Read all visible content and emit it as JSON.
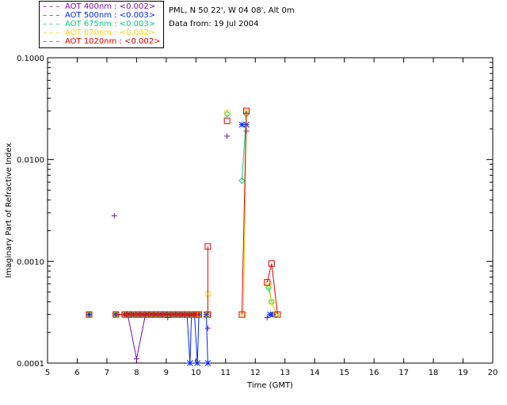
{
  "header": {
    "location": "PML, N 50 22', W 04 08', Alt 0m",
    "date_line": "Data from: 19 Jul 2004"
  },
  "legend": [
    {
      "label": "AOT  400nm : <0.002>",
      "color": "#7a0aa8"
    },
    {
      "label": "AOT  500nm : <0.003>",
      "color": "#0026ff"
    },
    {
      "label": "AOT  675nm : <0.003>",
      "color": "#00cc77"
    },
    {
      "label": "AOT  870nm : <0.002>",
      "color": "#ffd400"
    },
    {
      "label": "AOT 1020nm : <0.002>",
      "color": "#e00000"
    }
  ],
  "chart_data": {
    "type": "line",
    "xlabel": "Time (GMT)",
    "ylabel": "Imaginary Part of Refractive Index",
    "xlim": [
      5,
      20
    ],
    "ylim": [
      0.0001,
      0.1
    ],
    "yscale": "log",
    "x_ticks": [
      "5",
      "6",
      "7",
      "8",
      "9",
      "10",
      "11",
      "12",
      "13",
      "14",
      "15",
      "16",
      "17",
      "18",
      "19",
      "20"
    ],
    "y_ticks": [
      {
        "value": 0.0001,
        "label": "0.0001"
      },
      {
        "value": 0.001,
        "label": "0.0010"
      },
      {
        "value": 0.01,
        "label": "0.0100"
      },
      {
        "value": 0.1,
        "label": "0.1000"
      }
    ],
    "series": [
      {
        "name": "AOT  400nm",
        "color": "#7a0aa8",
        "marker": "plus",
        "segments": [
          [
            [
              7.25,
              0.0028
            ]
          ],
          [
            [
              7.7,
              0.0003
            ],
            [
              8.0,
              0.00011
            ],
            [
              8.3,
              0.0003
            ]
          ],
          [
            [
              9.05,
              0.00028
            ]
          ],
          [
            [
              10.4,
              0.00022
            ]
          ],
          [
            [
              11.05,
              0.017
            ]
          ],
          [
            [
              11.7,
              0.019
            ]
          ],
          [
            [
              12.4,
              0.00028
            ]
          ]
        ]
      },
      {
        "name": "AOT  500nm",
        "color": "#0026ff",
        "marker": "star",
        "segments": [
          [
            [
              6.4,
              0.0003
            ]
          ],
          [
            [
              7.3,
              0.0003
            ],
            [
              7.6,
              0.0003
            ],
            [
              7.75,
              0.0003
            ],
            [
              7.9,
              0.0003
            ],
            [
              8.05,
              0.0003
            ],
            [
              8.2,
              0.0003
            ],
            [
              8.35,
              0.0003
            ],
            [
              8.5,
              0.0003
            ],
            [
              8.65,
              0.0003
            ],
            [
              8.8,
              0.0003
            ],
            [
              8.95,
              0.0003
            ],
            [
              9.1,
              0.0003
            ],
            [
              9.25,
              0.0003
            ],
            [
              9.4,
              0.0003
            ],
            [
              9.55,
              0.0003
            ],
            [
              9.7,
              0.0003
            ],
            [
              9.8,
              0.0001
            ],
            [
              9.85,
              0.0003
            ],
            [
              9.95,
              0.0003
            ],
            [
              10.05,
              0.0001
            ],
            [
              10.1,
              0.0003
            ]
          ],
          [
            [
              10.35,
              0.0003
            ],
            [
              10.4,
              0.0001
            ]
          ],
          [
            [
              11.55,
              0.022
            ],
            [
              11.7,
              0.022
            ]
          ],
          [
            [
              12.5,
              0.0003
            ],
            [
              12.6,
              0.0003
            ]
          ]
        ]
      },
      {
        "name": "AOT  675nm",
        "color": "#00cc77",
        "marker": "diamond",
        "segments": [
          [
            [
              6.4,
              0.0003
            ]
          ],
          [
            [
              7.3,
              0.0003
            ],
            [
              7.6,
              0.0003
            ],
            [
              7.75,
              0.0003
            ],
            [
              7.9,
              0.0003
            ],
            [
              8.05,
              0.0003
            ],
            [
              8.2,
              0.0003
            ],
            [
              8.35,
              0.0003
            ],
            [
              8.5,
              0.0003
            ],
            [
              8.65,
              0.0003
            ],
            [
              8.8,
              0.0003
            ],
            [
              8.95,
              0.0003
            ],
            [
              9.1,
              0.0003
            ],
            [
              9.25,
              0.0003
            ],
            [
              9.4,
              0.0003
            ],
            [
              9.55,
              0.0003
            ],
            [
              9.7,
              0.0003
            ],
            [
              9.85,
              0.0003
            ],
            [
              10.0,
              0.0003
            ],
            [
              10.1,
              0.0003
            ]
          ],
          [
            [
              10.4,
              0.0003
            ]
          ],
          [
            [
              11.05,
              0.028
            ]
          ],
          [
            [
              11.55,
              0.0062
            ],
            [
              11.7,
              0.028
            ]
          ],
          [
            [
              12.45,
              0.00055
            ],
            [
              12.55,
              0.0004
            ],
            [
              12.7,
              0.0003
            ]
          ]
        ]
      },
      {
        "name": "AOT  870nm",
        "color": "#ffd400",
        "marker": "circle",
        "segments": [
          [
            [
              6.4,
              0.0003
            ]
          ],
          [
            [
              7.3,
              0.0003
            ],
            [
              7.6,
              0.0003
            ],
            [
              7.75,
              0.0003
            ],
            [
              7.9,
              0.0003
            ],
            [
              8.05,
              0.0003
            ],
            [
              8.2,
              0.0003
            ],
            [
              8.35,
              0.0003
            ],
            [
              8.5,
              0.0003
            ],
            [
              8.65,
              0.0003
            ],
            [
              8.8,
              0.0003
            ],
            [
              8.95,
              0.0003
            ],
            [
              9.1,
              0.0003
            ],
            [
              9.25,
              0.0003
            ],
            [
              9.4,
              0.0003
            ],
            [
              9.55,
              0.0003
            ],
            [
              9.7,
              0.0003
            ],
            [
              9.85,
              0.0003
            ],
            [
              10.0,
              0.0003
            ],
            [
              10.1,
              0.0003
            ]
          ],
          [
            [
              10.4,
              0.0003
            ],
            [
              10.4,
              0.00048
            ]
          ],
          [
            [
              11.05,
              0.029
            ]
          ],
          [
            [
              11.6,
              0.0003
            ],
            [
              11.7,
              0.029
            ]
          ],
          [
            [
              12.45,
              0.0006
            ],
            [
              12.55,
              0.0004
            ],
            [
              12.7,
              0.0003
            ]
          ]
        ]
      },
      {
        "name": "AOT 1020nm",
        "color": "#e00000",
        "marker": "square",
        "segments": [
          [
            [
              6.4,
              0.0003
            ]
          ],
          [
            [
              7.3,
              0.0003
            ],
            [
              7.6,
              0.0003
            ],
            [
              7.75,
              0.0003
            ],
            [
              7.9,
              0.0003
            ],
            [
              8.05,
              0.0003
            ],
            [
              8.2,
              0.0003
            ],
            [
              8.35,
              0.0003
            ],
            [
              8.5,
              0.0003
            ],
            [
              8.65,
              0.0003
            ],
            [
              8.8,
              0.0003
            ],
            [
              8.95,
              0.0003
            ],
            [
              9.1,
              0.0003
            ],
            [
              9.25,
              0.0003
            ],
            [
              9.4,
              0.0003
            ],
            [
              9.55,
              0.0003
            ],
            [
              9.7,
              0.0003
            ],
            [
              9.85,
              0.0003
            ],
            [
              10.0,
              0.0003
            ],
            [
              10.1,
              0.0003
            ]
          ],
          [
            [
              10.4,
              0.0003
            ],
            [
              10.4,
              0.0014
            ]
          ],
          [
            [
              11.05,
              0.024
            ]
          ],
          [
            [
              11.55,
              0.0003
            ],
            [
              11.7,
              0.03
            ]
          ],
          [
            [
              12.4,
              0.00062
            ],
            [
              12.55,
              0.00095
            ],
            [
              12.75,
              0.0003
            ]
          ]
        ]
      }
    ]
  }
}
